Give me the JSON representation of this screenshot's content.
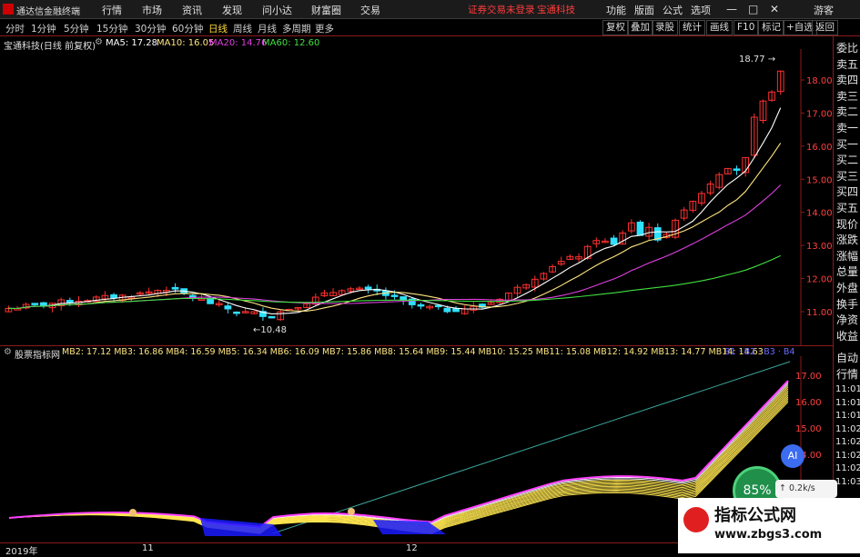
{
  "app": {
    "title": "通达信金融终端",
    "menus": [
      "行情",
      "市场",
      "资讯",
      "发现",
      "问小达",
      "财富圈",
      "交易"
    ],
    "risk_notice": "证券交易未登录",
    "stock_link": "宝通科技",
    "right_menus": [
      "功能",
      "版面",
      "公式",
      "选项"
    ],
    "guest": "游客",
    "window_controls": [
      "—",
      "□",
      "✕"
    ]
  },
  "periods": {
    "items": [
      "分时",
      "1分钟",
      "5分钟",
      "15分钟",
      "30分钟",
      "60分钟",
      "日线",
      "周线",
      "月线",
      "多周期",
      "更多"
    ],
    "active": "日线"
  },
  "toolbar": [
    "复权",
    "叠加",
    "录股",
    "统计",
    "画线",
    "F10",
    "标记",
    "+自选",
    "返回"
  ],
  "main_chart": {
    "stock_title": "宝通科技(日线 前复权)",
    "ma": [
      {
        "label": "MA5: 17.28",
        "color": "#ffffff"
      },
      {
        "label": "MA10: 16.05",
        "color": "#ffe680"
      },
      {
        "label": "MA20: 14.76",
        "color": "#e040e0"
      },
      {
        "label": "MA60: 12.60",
        "color": "#40e040"
      }
    ],
    "high_label": "18.77",
    "low_label": "10.48",
    "price_axis": [
      "18.00",
      "17.00",
      "16.00",
      "15.00",
      "14.00",
      "13.00",
      "12.00",
      "11.00"
    ]
  },
  "indicator": {
    "name": "股票指标网",
    "values": "MB2: 17.12  MB3: 16.86  MB4: 16.59  MB5: 16.34  MB6: 16.09  MB7: 15.86  MB8: 15.64  MB9: 15.44  MB10: 15.25  MB11: 15.08  MB12: 14.92  MB13: 14.77  MB14: 14.63",
    "tail": "B1 · B2 · B3 · B4",
    "axis": [
      "17.00",
      "16.00",
      "15.00",
      "14.00"
    ]
  },
  "date_axis": [
    "2019年",
    "11",
    "12"
  ],
  "side_panel": [
    "委比",
    "卖五",
    "卖四",
    "卖三",
    "卖二",
    "卖一",
    "买一",
    "买二",
    "买三",
    "买四",
    "买五",
    "现价",
    "涨跌",
    "涨幅",
    "总量",
    "外盘",
    "换手",
    "净资",
    "收益",
    "自动",
    "行情"
  ],
  "side_times": [
    "11:01",
    "11:01",
    "11:01",
    "11:02",
    "11:02",
    "11:02",
    "11:02",
    "11:03"
  ],
  "widgets": {
    "ai": "AI",
    "speed": "85%",
    "speed_rate": "0.2k/s"
  },
  "watermark": {
    "title": "指标公式网",
    "url": "www.zbgs3.com"
  },
  "colors": {
    "up": "#ff3030",
    "down": "#30e0ff",
    "accent": "#ffd83a"
  }
}
